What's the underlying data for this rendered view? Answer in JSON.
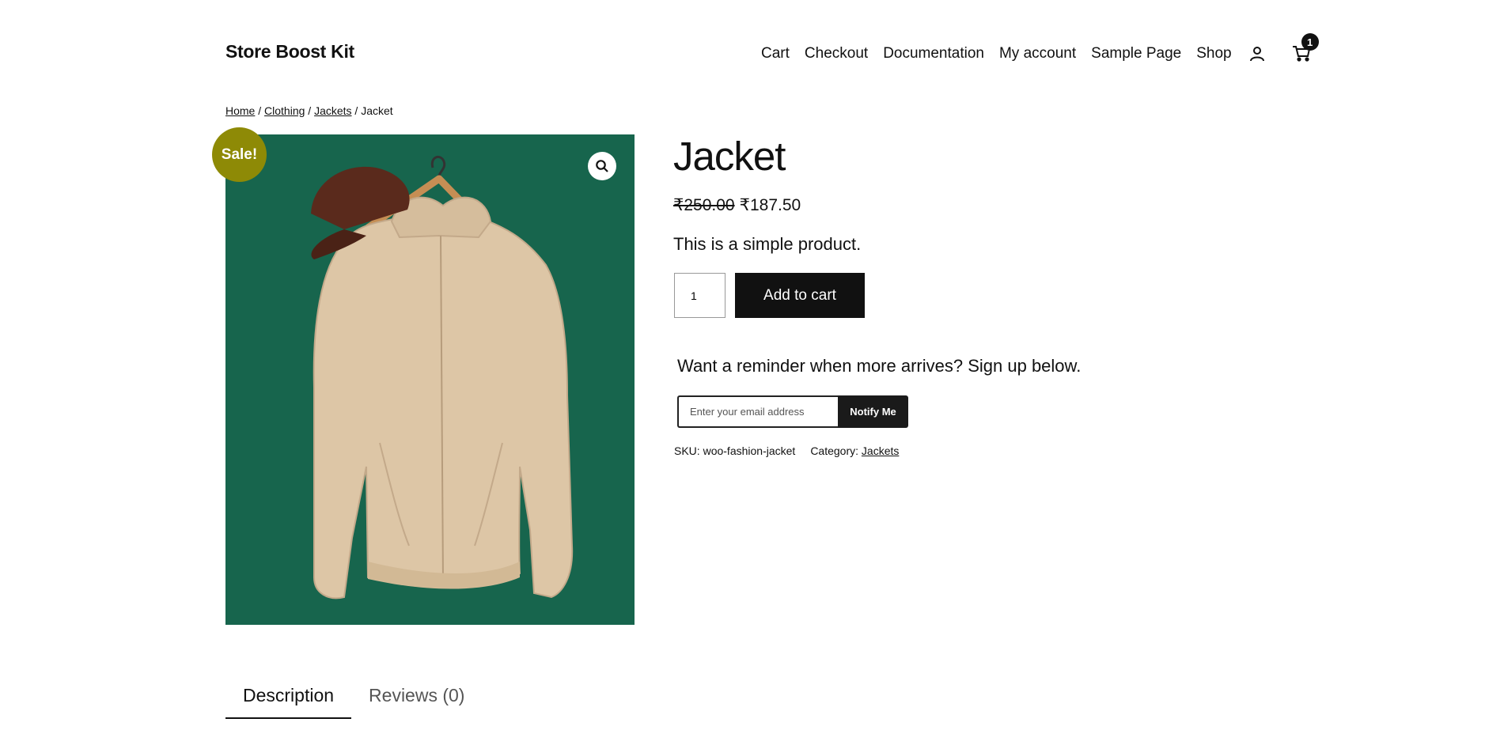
{
  "header": {
    "site_title": "Store Boost Kit",
    "nav": [
      "Cart",
      "Checkout",
      "Documentation",
      "My account",
      "Sample Page",
      "Shop"
    ],
    "cart_count": "1"
  },
  "breadcrumb": {
    "items": [
      "Home",
      "Clothing",
      "Jackets"
    ],
    "current": "Jacket",
    "separator": " / "
  },
  "product": {
    "sale_badge": "Sale!",
    "title": "Jacket",
    "price_old": "₹250.00",
    "price_new": "₹187.50",
    "short_description": "This is a simple product.",
    "quantity": "1",
    "add_to_cart_label": "Add to cart",
    "image_background": "#17654d"
  },
  "notify": {
    "heading": "Want a reminder when more arrives? Sign up below.",
    "email_placeholder": "Enter your email address",
    "button_label": "Notify Me"
  },
  "meta": {
    "sku_label": "SKU:",
    "sku_value": "woo-fashion-jacket",
    "category_label": "Category:",
    "category_value": "Jackets"
  },
  "tabs": [
    {
      "label": "Description",
      "active": true
    },
    {
      "label": "Reviews (0)",
      "active": false
    }
  ],
  "colors": {
    "accent_dark": "#111111",
    "sale_badge": "#8e8a06"
  }
}
